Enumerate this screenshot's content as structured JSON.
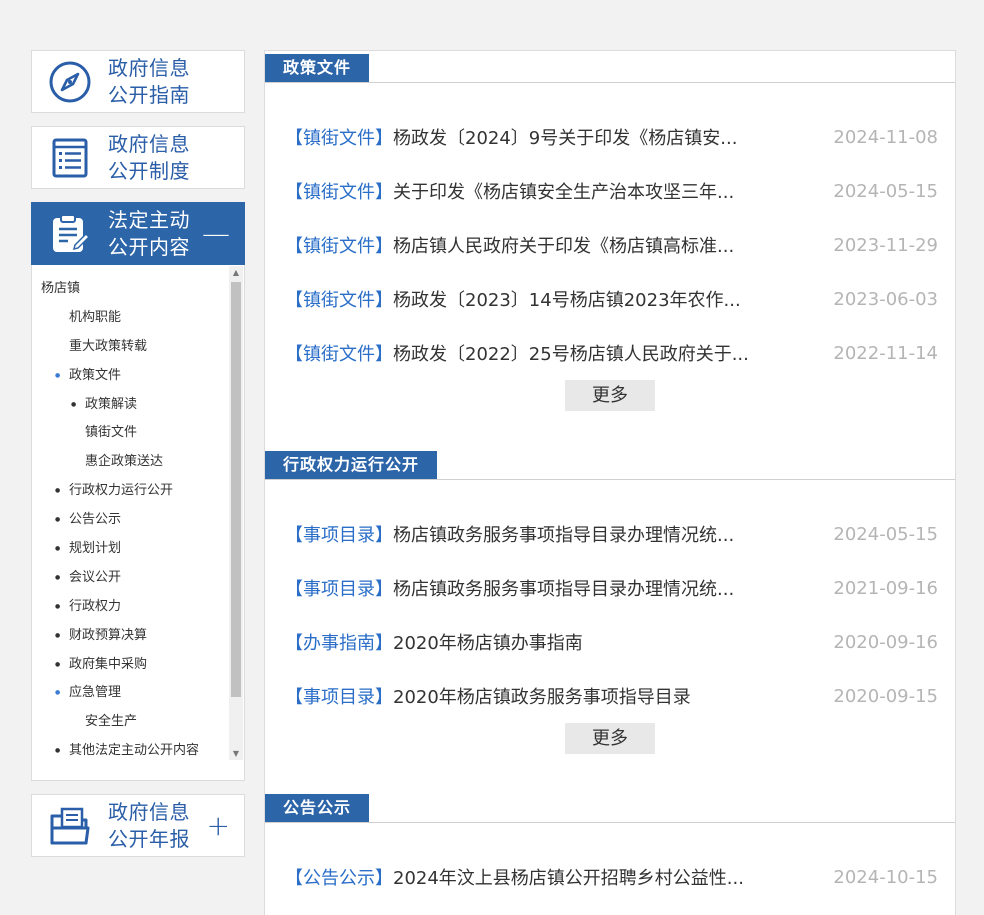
{
  "sidebar": {
    "cards": [
      {
        "line1": "政府信息",
        "line2": "公开指南",
        "icon": "compass-icon"
      },
      {
        "line1": "政府信息",
        "line2": "公开制度",
        "icon": "list-document-icon"
      },
      {
        "line1": "法定主动",
        "line2": "公开内容",
        "icon": "clipboard-edit-icon",
        "toggle": "—"
      },
      {
        "line1": "政府信息",
        "line2": "公开年报",
        "icon": "folder-document-icon",
        "toggle": "+"
      }
    ],
    "tree": [
      {
        "label": "杨店镇",
        "level": 0,
        "bullet": ""
      },
      {
        "label": "机构职能",
        "level": 1,
        "bullet": ""
      },
      {
        "label": "重大政策转载",
        "level": 1,
        "bullet": ""
      },
      {
        "label": "政策文件",
        "level": 1,
        "bullet": "blue"
      },
      {
        "label": "政策解读",
        "level": 2,
        "bullet": "dark"
      },
      {
        "label": "镇街文件",
        "level": 2,
        "bullet": ""
      },
      {
        "label": "惠企政策送达",
        "level": 2,
        "bullet": ""
      },
      {
        "label": "行政权力运行公开",
        "level": 1,
        "bullet": "dark"
      },
      {
        "label": "公告公示",
        "level": 1,
        "bullet": "dark"
      },
      {
        "label": "规划计划",
        "level": 1,
        "bullet": "dark"
      },
      {
        "label": "会议公开",
        "level": 1,
        "bullet": "dark"
      },
      {
        "label": "行政权力",
        "level": 1,
        "bullet": "dark"
      },
      {
        "label": "财政预算决算",
        "level": 1,
        "bullet": "dark"
      },
      {
        "label": "政府集中采购",
        "level": 1,
        "bullet": "dark"
      },
      {
        "label": "应急管理",
        "level": 1,
        "bullet": "blue"
      },
      {
        "label": "安全生产",
        "level": 2,
        "bullet": ""
      },
      {
        "label": "其他法定主动公开内容",
        "level": 1,
        "bullet": "dark"
      }
    ]
  },
  "sections": [
    {
      "title": "政策文件",
      "more": "更多",
      "items": [
        {
          "tag": "【镇街文件】",
          "text": "杨政发〔2024〕9号关于印发《杨店镇安...",
          "date": "2024-11-08"
        },
        {
          "tag": "【镇街文件】",
          "text": "关于印发《杨店镇安全生产治本攻坚三年...",
          "date": "2024-05-15"
        },
        {
          "tag": "【镇街文件】",
          "text": "杨店镇人民政府关于印发《杨店镇高标准...",
          "date": "2023-11-29"
        },
        {
          "tag": "【镇街文件】",
          "text": "杨政发〔2023〕14号杨店镇2023年农作...",
          "date": "2023-06-03"
        },
        {
          "tag": "【镇街文件】",
          "text": "杨政发〔2022〕25号杨店镇人民政府关于...",
          "date": "2022-11-14"
        }
      ]
    },
    {
      "title": "行政权力运行公开",
      "more": "更多",
      "items": [
        {
          "tag": "【事项目录】",
          "text": "杨店镇政务服务事项指导目录办理情况统...",
          "date": "2024-05-15"
        },
        {
          "tag": "【事项目录】",
          "text": "杨店镇政务服务事项指导目录办理情况统...",
          "date": "2021-09-16"
        },
        {
          "tag": "【办事指南】",
          "text": "2020年杨店镇办事指南",
          "date": "2020-09-16"
        },
        {
          "tag": "【事项目录】",
          "text": "2020年杨店镇政务服务事项指导目录",
          "date": "2020-09-15"
        }
      ]
    },
    {
      "title": "公告公示",
      "items": [
        {
          "tag": "【公告公示】",
          "text": "2024年汶上县杨店镇公开招聘乡村公益性...",
          "date": "2024-10-15"
        }
      ]
    }
  ]
}
